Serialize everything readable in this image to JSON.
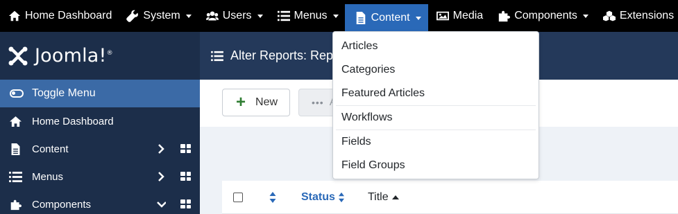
{
  "topbar": {
    "items": [
      {
        "label": "Home Dashboard",
        "icon": "home-icon",
        "caret": false
      },
      {
        "label": "System",
        "icon": "wrench-icon",
        "caret": true
      },
      {
        "label": "Users",
        "icon": "users-icon",
        "caret": true
      },
      {
        "label": "Menus",
        "icon": "list-icon",
        "caret": true
      },
      {
        "label": "Content",
        "icon": "file-icon",
        "caret": true,
        "active": true
      },
      {
        "label": "Media",
        "icon": "image-icon",
        "caret": false
      },
      {
        "label": "Components",
        "icon": "puzzle-icon",
        "caret": true
      },
      {
        "label": "Extensions",
        "icon": "cubes-icon",
        "caret": true
      }
    ]
  },
  "brand": {
    "name": "Joomla!",
    "mark": "®"
  },
  "sidebar": {
    "toggle_label": "Toggle Menu",
    "items": [
      {
        "label": "Home Dashboard",
        "icon": "home-icon"
      },
      {
        "label": "Content",
        "icon": "file-icon",
        "chevron": "right"
      },
      {
        "label": "Menus",
        "icon": "list-icon",
        "chevron": "right"
      },
      {
        "label": "Components",
        "icon": "puzzle-icon",
        "chevron": "down"
      }
    ]
  },
  "page": {
    "title": "Alter Reports: Rep"
  },
  "toolbar": {
    "new_label": "New",
    "actions_label": "A"
  },
  "table": {
    "status_header": "Status",
    "title_header": "Title"
  },
  "dropdown": {
    "items": [
      "Articles",
      "Categories",
      "Featured Articles",
      "Workflows",
      "Fields",
      "Field Groups"
    ]
  },
  "colors": {
    "topbar": "#000000",
    "active": "#2a69b8",
    "sidebar": "#1c2e4a",
    "toggle": "#3b6aa6",
    "titlebar": "#24395a"
  }
}
